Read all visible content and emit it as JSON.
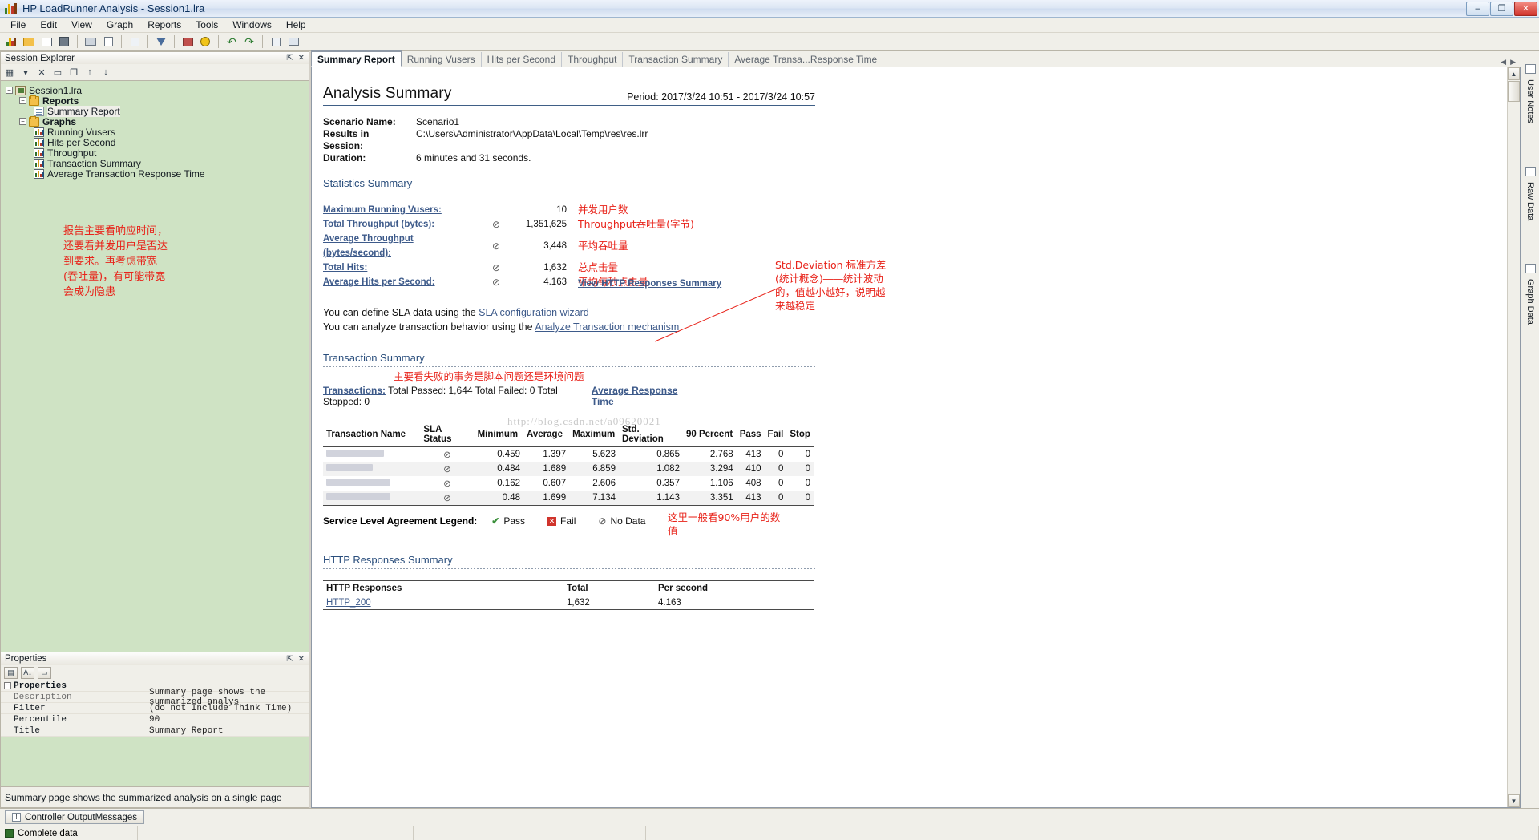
{
  "window": {
    "title": "HP LoadRunner Analysis - Session1.lra",
    "minimize": "–",
    "maximize": "❐",
    "close": "✕"
  },
  "menu": [
    "File",
    "Edit",
    "View",
    "Graph",
    "Reports",
    "Tools",
    "Windows",
    "Help"
  ],
  "session_explorer": {
    "title": "Session Explorer",
    "pin": "⇱",
    "close": "✕",
    "tools": [
      "new-graph",
      "dropdown",
      "delete",
      "rename",
      "duplicate",
      "move-up",
      "move-down"
    ],
    "root": "Session1.lra",
    "folders": [
      {
        "label": "Reports",
        "children": [
          "Summary Report"
        ]
      },
      {
        "label": "Graphs",
        "children": [
          "Running Vusers",
          "Hits per Second",
          "Throughput",
          "Transaction Summary",
          "Average Transaction Response Time"
        ]
      }
    ],
    "annotation": "报告主要看响应时间，还要看并发用户是否达到要求。再考虑带宽(吞吐量)，有可能带宽会成为隐患"
  },
  "properties": {
    "title": "Properties",
    "pin": "⇱",
    "close": "✕",
    "category": "Properties",
    "rows": [
      {
        "key": "Description",
        "value": "Summary page shows the summarized analys"
      },
      {
        "key": "Filter",
        "value": "(do not Include Think Time)"
      },
      {
        "key": "Percentile",
        "value": "90"
      },
      {
        "key": "Title",
        "value": "Summary Report"
      }
    ],
    "footer": "Summary page shows the summarized analysis on a single page"
  },
  "tabs": [
    "Summary Report",
    "Running Vusers",
    "Hits per Second",
    "Throughput",
    "Transaction Summary",
    "Average Transa...Response Time"
  ],
  "active_tab": "Summary Report",
  "report": {
    "heading": "Analysis Summary",
    "period": "Period: 2017/3/24 10:51 - 2017/3/24 10:57",
    "scenario_label": "Scenario Name:",
    "scenario_value": "Scenario1",
    "results_label": "Results in Session:",
    "results_value": "C:\\Users\\Administrator\\AppData\\Local\\Temp\\res\\res.lrr",
    "duration_label": "Duration:",
    "duration_value": "6 minutes and 31 seconds.",
    "statistics_heading": "Statistics Summary",
    "statistics": [
      {
        "name": "Maximum Running Vusers:",
        "icon": "",
        "value": "10",
        "note": "并发用户数"
      },
      {
        "name": "Total Throughput (bytes):",
        "icon": "⊘",
        "value": "1,351,625",
        "note": "Throughput吞吐量(字节)"
      },
      {
        "name": "Average Throughput (bytes/second):",
        "icon": "⊘",
        "value": "3,448",
        "note": "平均吞吐量"
      },
      {
        "name": "Total Hits:",
        "icon": "⊘",
        "value": "1,632",
        "note": "总点击量"
      },
      {
        "name": "Average Hits per Second:",
        "icon": "⊘",
        "value": "4.163",
        "note": "平均每秒点击量"
      }
    ],
    "http_link_overlay": "View HTTP Responses Summary",
    "hints": [
      {
        "prefix": "You can define SLA data using the ",
        "link": "SLA configuration wizard"
      },
      {
        "prefix": "You can analyze transaction behavior using the ",
        "link": "Analyze Transaction mechanism"
      }
    ],
    "transaction_heading": "Transaction Summary",
    "transaction_note": "主要看失败的事务是脚本问题还是环境问题",
    "transactions_label": "Transactions:",
    "transactions_text": "Total Passed: 1,644 Total Failed: 0 Total Stopped: 0",
    "avg_response_link": "Average Response Time",
    "watermark": "http://blog.csdn.net/a09620021",
    "table": {
      "columns": [
        "Transaction Name",
        "SLA Status",
        "Minimum",
        "Average",
        "Maximum",
        "Std. Deviation",
        "90 Percent",
        "Pass",
        "Fail",
        "Stop"
      ],
      "rows": [
        {
          "name": "",
          "sla": "⊘",
          "minimum": "0.459",
          "average": "1.397",
          "maximum": "5.623",
          "std": "0.865",
          "p90": "2.768",
          "pass": "413",
          "fail": "0",
          "stop": "0"
        },
        {
          "name": "",
          "sla": "⊘",
          "minimum": "0.484",
          "average": "1.689",
          "maximum": "6.859",
          "std": "1.082",
          "p90": "3.294",
          "pass": "410",
          "fail": "0",
          "stop": "0"
        },
        {
          "name": "",
          "sla": "⊘",
          "minimum": "0.162",
          "average": "0.607",
          "maximum": "2.606",
          "std": "0.357",
          "p90": "1.106",
          "pass": "408",
          "fail": "0",
          "stop": "0"
        },
        {
          "name": "",
          "sla": "⊘",
          "minimum": "0.48",
          "average": "1.699",
          "maximum": "7.134",
          "std": "1.143",
          "p90": "3.351",
          "pass": "413",
          "fail": "0",
          "stop": "0"
        }
      ]
    },
    "std_annotation": "Std.Deviation 标准方差(统计概念)――统计波动的，值越小越好，说明越来越稳定",
    "p90_annotation": "这里一般看90%用户的数值",
    "legend_label": "Service Level Agreement Legend:",
    "legend": [
      {
        "icon": "✔",
        "label": "Pass",
        "kind": "pass"
      },
      {
        "icon": "✕",
        "label": "Fail",
        "kind": "fail"
      },
      {
        "icon": "⊘",
        "label": "No Data",
        "kind": "nodata"
      }
    ],
    "http_heading": "HTTP Responses Summary",
    "http_table": {
      "columns": [
        "HTTP Responses",
        "Total",
        "Per second"
      ],
      "rows": [
        {
          "code": "HTTP_200",
          "total": "1,632",
          "per_second": "4.163"
        }
      ]
    }
  },
  "right_dock": [
    {
      "label": "User Notes",
      "icon": "notes-icon"
    },
    {
      "label": "Raw Data",
      "icon": "raw-data-icon"
    },
    {
      "label": "Graph Data",
      "icon": "graph-data-icon"
    }
  ],
  "bottom": {
    "output_tab": "Controller OutputMessages",
    "status": "Complete data"
  },
  "colors": {
    "accent": "#3d5a8a",
    "annotation": "#e8231a",
    "tree_bg": "#cfe3c4",
    "chrome": "#f0efe9"
  }
}
